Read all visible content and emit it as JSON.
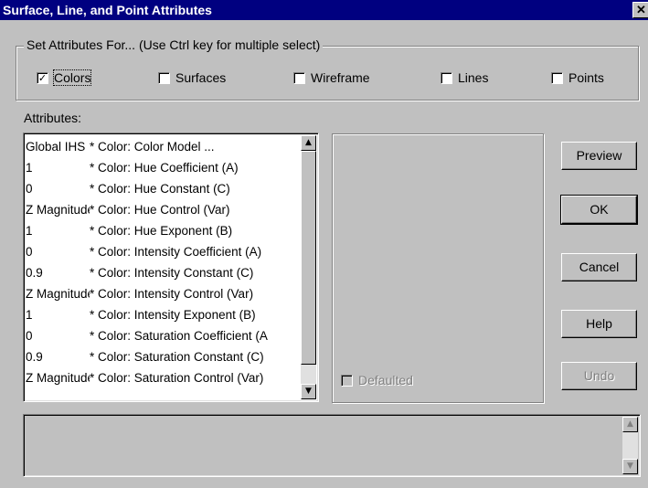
{
  "window": {
    "title": "Surface, Line, and Point Attributes",
    "close_glyph": "✕"
  },
  "set_attributes": {
    "legend": "Set Attributes For... (Use Ctrl key for multiple select)",
    "options": [
      {
        "label": "Colors",
        "checked": true
      },
      {
        "label": "Surfaces",
        "checked": false
      },
      {
        "label": "Wireframe",
        "checked": false
      },
      {
        "label": "Lines",
        "checked": false
      },
      {
        "label": "Points",
        "checked": false
      }
    ]
  },
  "attributes_label": "Attributes:",
  "attributes_list": [
    {
      "value": "Global IHS",
      "name": "* Color: Color Model      ..."
    },
    {
      "value": "1",
      "name": "* Color: Hue Coefficient (A)"
    },
    {
      "value": "0",
      "name": "* Color: Hue Constant (C)"
    },
    {
      "value": "Z Magnitude",
      "name": "* Color: Hue Control (Var)"
    },
    {
      "value": "1",
      "name": "* Color: Hue Exponent (B)"
    },
    {
      "value": "0",
      "name": "* Color: Intensity Coefficient (A)"
    },
    {
      "value": "0.9",
      "name": "* Color: Intensity Constant (C)"
    },
    {
      "value": "Z Magnitude",
      "name": "* Color: Intensity Control (Var)"
    },
    {
      "value": "1",
      "name": "* Color: Intensity Exponent (B)"
    },
    {
      "value": "0",
      "name": "* Color: Saturation Coefficient (A"
    },
    {
      "value": "0.9",
      "name": "* Color: Saturation Constant (C)"
    },
    {
      "value": "Z Magnitude",
      "name": "* Color: Saturation Control (Var)"
    }
  ],
  "defaulted": {
    "label": "Defaulted",
    "checked": false
  },
  "buttons": {
    "preview": "Preview",
    "ok": "OK",
    "cancel": "Cancel",
    "help": "Help",
    "undo": "Undo"
  },
  "scroll": {
    "up_glyph": "▲",
    "down_glyph": "▼"
  },
  "colors": {
    "titlebar": "#000080",
    "face": "#c0c0c0",
    "disabled_text": "#808080"
  }
}
